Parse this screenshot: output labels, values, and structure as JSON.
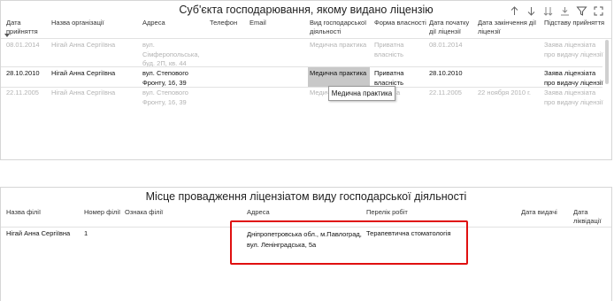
{
  "top": {
    "title": "Суб'єкта господарювання, якому видано ліцензію",
    "columns": [
      "Дата прийняття",
      "Назва організації",
      "Адреса",
      "Телефон",
      "Email",
      "Вид господарської діяльності",
      "Форма власності",
      "Дата початку дії ліцензії",
      "Дата закінчення дії ліцензії",
      "Підставу прийняття"
    ],
    "rows": [
      {
        "date": "08.01.2014",
        "org": "Нігай Анна Сергіївна",
        "address": "вул. Сімферопольська, буд. 2П, кв. 44",
        "phone": "",
        "email": "",
        "activity": "Медична практика",
        "ownership": "Приватна власність",
        "start": "08.01.2014",
        "end": "",
        "basis": "Заява ліцензіата про видачу ліцензії"
      },
      {
        "date": "28.10.2010",
        "org": "Нігай Анна Сергіївна",
        "address": "вул. Степового Фронту, 16, 39",
        "phone": "",
        "email": "",
        "activity": "Медична практика",
        "ownership": "Приватна власність",
        "start": "28.10.2010",
        "end": "",
        "basis": "Заява ліцензіата про видачу ліцензії"
      },
      {
        "date": "22.11.2005",
        "org": "Нігай Анна Сергіївна",
        "address": "вул. Степового Фронту, 16, 39",
        "phone": "",
        "email": "",
        "activity": "Медич",
        "ownership": "а",
        "start": "22.11.2005",
        "end": "22 ноября 2010 г.",
        "basis": "Заява ліцензіата про видачу ліцензії"
      }
    ],
    "tooltip": "Медична практика",
    "toolbar_icons": [
      "arrow-up-icon",
      "arrow-down-icon",
      "double-arrow-down-icon",
      "expand-down-icon",
      "filter-icon",
      "focus-mode-icon"
    ]
  },
  "bottom": {
    "title": "Місце провадження ліцензіатом виду господарської діяльності",
    "columns": [
      "Назва філії",
      "Номер філії",
      "Ознака філії",
      "Адреса",
      "Перелік робіт",
      "Дата видачі",
      "Дата ліквідації"
    ],
    "rows": [
      {
        "name": "Нігай Анна Сергіївна",
        "number": "1",
        "sign": "",
        "address": "Дніпропетровська обл., м.Павлоград, вул. Ленінградська, 5а",
        "works": "Терапевтична стоматологія",
        "issue_date": "",
        "liquidation_date": ""
      }
    ]
  },
  "colors": {
    "highlight": "#e01010",
    "selected_cell": "#c8c8c8",
    "faded_text": "#b3b3b3"
  }
}
